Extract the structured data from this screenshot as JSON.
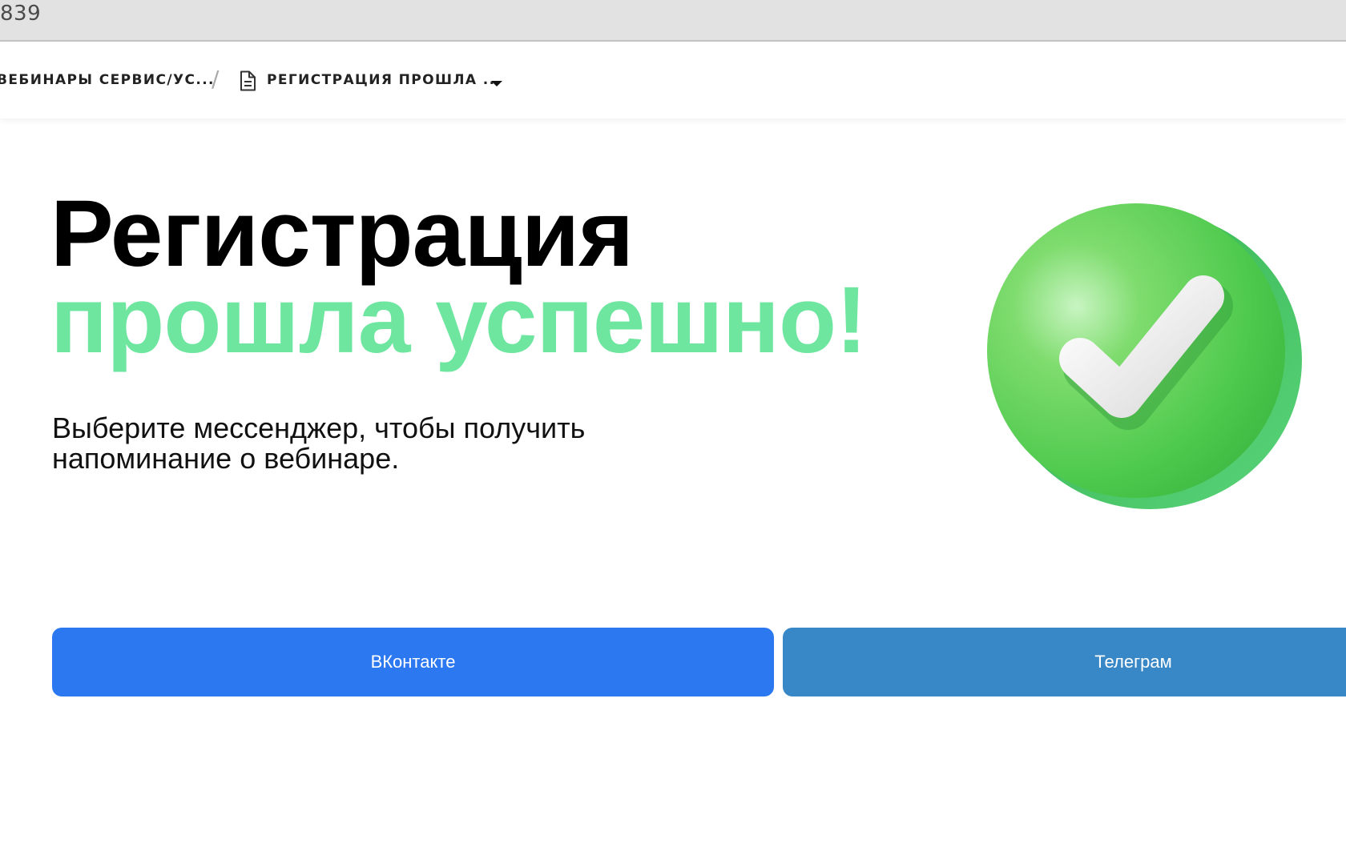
{
  "address_bar": {
    "text": "839"
  },
  "breadcrumb": {
    "parent": "ВЕБИНАРЫ СЕРВИС/УС...",
    "separator": "/",
    "current": "РЕГИСТРАЦИЯ ПРОШЛА ...",
    "icons": [
      "document-icon",
      "caret-down-icon"
    ]
  },
  "hero": {
    "title_line1": "Регистрация",
    "title_line2": "прошла успешно!",
    "subtitle_line1": "Выберите мессенджер, чтобы получить",
    "subtitle_line2": "напоминание о вебинаре.",
    "badge_icon": "green-checkmark-icon"
  },
  "buttons": {
    "vk_label": "ВКонтакте",
    "telegram_label": "Телеграм"
  },
  "colors": {
    "accent_green": "#6fe6a0",
    "vk_blue": "#2b78f0",
    "telegram_blue": "#3887c6",
    "badge_green": "#4cc94c"
  }
}
